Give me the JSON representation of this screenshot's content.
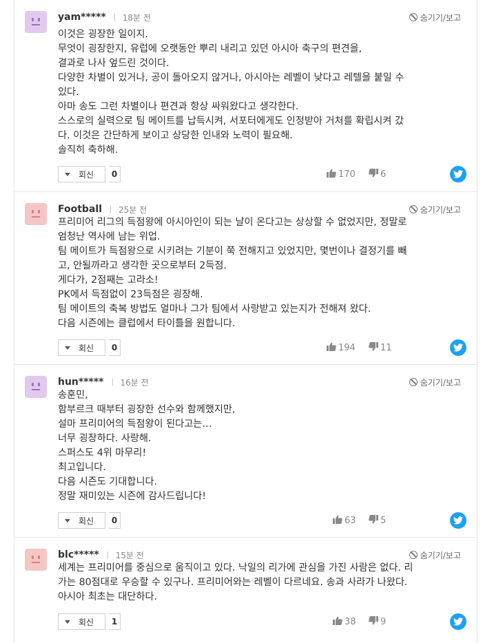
{
  "report_label": "숨기기/보고",
  "reply_label": "회신",
  "comments": [
    {
      "name": "yam*****",
      "time": "18분 전",
      "avatar_color": "#e2c9ee",
      "avatar_feature_color": "#9b6fbe",
      "lines": [
        "이것은 굉장한 일이지.",
        "무엇이 굉장한지, 유럽에 오랫동안 뿌리 내리고 있던 아시아 축구의 편견을,",
        "결과로 나사 엎드린 것이다.",
        "다양한 차별이 있거나, 공이 돌아오지 않거나, 아시아는 레벨이 낮다고 레텔을 붙일 수",
        "있다.",
        "아마 송도 그런 차별이나 편견과 항상 싸워왔다고 생각한다.",
        "스스로의 실력으로 팀 메이트를 납득시켜, 서포터에게도 인정받아 거처를 확립시켜 갔",
        "다. 이것은 간단하게 보이고 상당한 인내와 노력이 필요해.",
        "솔직히 축하해."
      ],
      "reply_count": "0",
      "likes": "170",
      "dislikes": "6"
    },
    {
      "name": "Football",
      "time": "25분 전",
      "avatar_color": "#f4c6c6",
      "avatar_feature_color": "#d97e7e",
      "lines": [
        "프리미어 리그의 득점왕에 아시아인이 되는 날이 온다고는 상상할 수 없었지만, 정말로",
        "엄청난 역사에 남는 위업.",
        "팀 메이트가 득점왕으로 시키려는 기분이 쭉 전해지고 있었지만, 몇번이나 결정기를 빼",
        "고, 안될까라고 생각한 곳으로부터 2득점.",
        "게다가, 2점째는 고라소!",
        "PK에서 득점없이 23득점은 굉장해.",
        "팀 메이트의 축복 방법도 얼마나 그가 팀에서 사랑받고 있는지가 전해져 왔다.",
        "다음 시즌에는 클럽에서 타이틀을 원합니다."
      ],
      "reply_count": "0",
      "likes": "194",
      "dislikes": "11"
    },
    {
      "name": "hun*****",
      "time": "16분 전",
      "avatar_color": "#e2c9ee",
      "avatar_feature_color": "#9b6fbe",
      "lines": [
        "송훈민,",
        "함부르크 때부터 굉장한 선수와 함께했지만,",
        "설마 프리미어의 득점왕이 된다고는…",
        "너무 굉장하다. 사랑해.",
        "스퍼스도 4위 마무리!",
        "최고입니다.",
        "다음 시즌도 기대합니다.",
        "정말 재미있는 시즌에 감사드립니다!"
      ],
      "reply_count": "0",
      "likes": "63",
      "dislikes": "5"
    },
    {
      "name": "blc*****",
      "time": "15분 전",
      "avatar_color": "#f4c6c6",
      "avatar_feature_color": "#d97e7e",
      "lines": [
        "세계는 프리미어를 중심으로 움직이고 있다. 낙일의 리가에 관심을 가진 사람은 없다. 리",
        "가는 80점대로 우승할 수 있구나. 프리미어와는 레벨이 다르네요. 송과 사라가 나왔다.",
        "아시아 최초는 대단하다."
      ],
      "reply_count": "1",
      "likes": "38",
      "dislikes": "9"
    }
  ]
}
